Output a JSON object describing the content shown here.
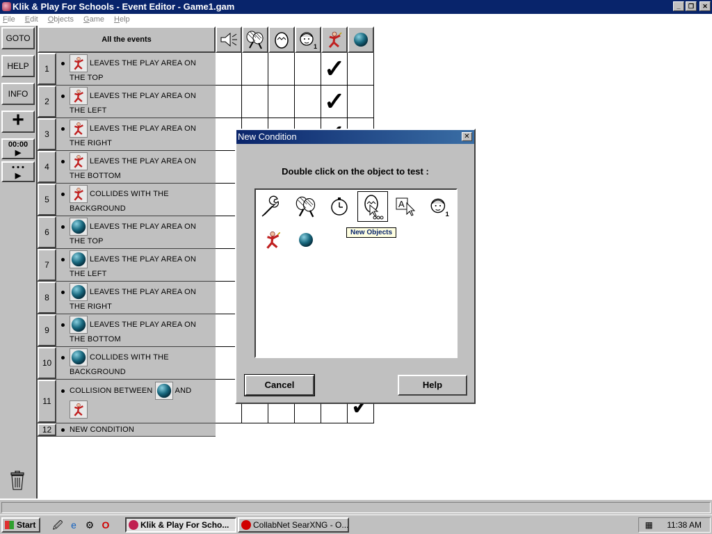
{
  "window": {
    "title": "Klik & Play For Schools - Event Editor - Game1.gam",
    "controls": [
      "_",
      "❐",
      "✕"
    ]
  },
  "menu": [
    "File",
    "Edit",
    "Objects",
    "Game",
    "Help"
  ],
  "sidebar": {
    "goto": "GOTO",
    "help": "HELP",
    "info": "INFO",
    "add": "+",
    "time": "00:00",
    "step": "• • •"
  },
  "grid": {
    "header": "All the events",
    "columns": [
      "speaker-icon",
      "racket-icon",
      "egg-icon",
      "player-face-icon",
      "player-sprite-icon",
      "ball-icon"
    ],
    "rows": [
      {
        "num": "1",
        "obj": "player-sprite",
        "line1": "LEAVES THE PLAY AREA ON",
        "line2": "THE TOP"
      },
      {
        "num": "2",
        "obj": "player-sprite",
        "line1": "LEAVES THE PLAY AREA ON",
        "line2": "THE LEFT"
      },
      {
        "num": "3",
        "obj": "player-sprite",
        "line1": "LEAVES THE PLAY AREA ON",
        "line2": "THE RIGHT"
      },
      {
        "num": "4",
        "obj": "player-sprite",
        "line1": "LEAVES THE PLAY AREA ON",
        "line2": "THE BOTTOM"
      },
      {
        "num": "5",
        "obj": "player-sprite",
        "line1": "COLLIDES WITH THE",
        "line2": "BACKGROUND"
      },
      {
        "num": "6",
        "obj": "ball",
        "line1": "LEAVES THE PLAY AREA ON",
        "line2": "THE TOP"
      },
      {
        "num": "7",
        "obj": "ball",
        "line1": "LEAVES THE PLAY AREA ON",
        "line2": "THE LEFT"
      },
      {
        "num": "8",
        "obj": "ball",
        "line1": "LEAVES THE PLAY AREA ON",
        "line2": "THE RIGHT"
      },
      {
        "num": "9",
        "obj": "ball",
        "line1": "LEAVES THE PLAY AREA ON",
        "line2": "THE BOTTOM"
      },
      {
        "num": "10",
        "obj": "ball",
        "line1": "COLLIDES WITH THE",
        "line2": "BACKGROUND"
      },
      {
        "num": "11",
        "line1_a": "COLLISION BETWEEN",
        "line1_b": "AND"
      },
      {
        "num": "12",
        "line1": "NEW CONDITION"
      }
    ],
    "checkmark": "✓"
  },
  "dialog": {
    "title": "New Condition",
    "close": "✕",
    "prompt": "Double click on the object to test :",
    "objects": [
      "wrench-icon",
      "racket-icon",
      "timer-icon",
      "new-objects-icon",
      "text-cursor-icon",
      "player-face-icon",
      "player-sprite-icon",
      "ball-icon"
    ],
    "tooltip": "New Objects",
    "cancel": "Cancel",
    "help": "Help"
  },
  "taskbar": {
    "start": "Start",
    "tasks": [
      "Klik & Play For Scho...",
      "CollabNet SearXNG - O..."
    ],
    "clock": "11:38 AM"
  },
  "colors": {
    "titlebar": "#08246b",
    "face": "#c0c0c0"
  }
}
